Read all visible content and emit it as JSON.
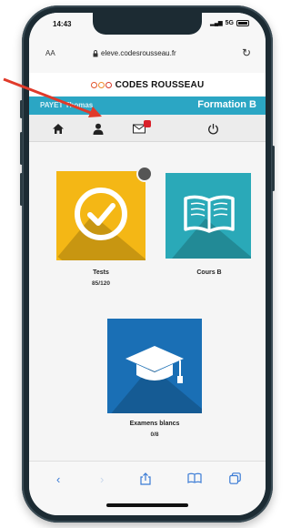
{
  "status_bar": {
    "time": "14:43",
    "network": "5G"
  },
  "browser": {
    "text_size_label": "AA",
    "url": "eleve.codesrousseau.fr"
  },
  "site": {
    "logo_text": "CODES ROUSSEAU"
  },
  "banner": {
    "user_name": "PAYET Thomas",
    "formation": "Formation B"
  },
  "nav_icons": [
    "home-icon",
    "user-icon",
    "mail-icon",
    "power-icon"
  ],
  "tiles": [
    {
      "label": "Tests",
      "sub": "85/120",
      "color": "#f4b715",
      "icon": "checkmark-icon"
    },
    {
      "label": "Cours B",
      "sub": "",
      "color": "#2aa9b8",
      "icon": "book-icon"
    },
    {
      "label": "Examens blancs",
      "sub": "0/8",
      "color": "#1a6fb5",
      "icon": "graduation-cap-icon"
    }
  ],
  "toolbar_icons": [
    "back-icon",
    "forward-icon",
    "share-icon",
    "bookmarks-icon",
    "tabs-icon"
  ],
  "colors": {
    "accent": "#2ba6c4",
    "annotation_arrow": "#e03a2a"
  }
}
